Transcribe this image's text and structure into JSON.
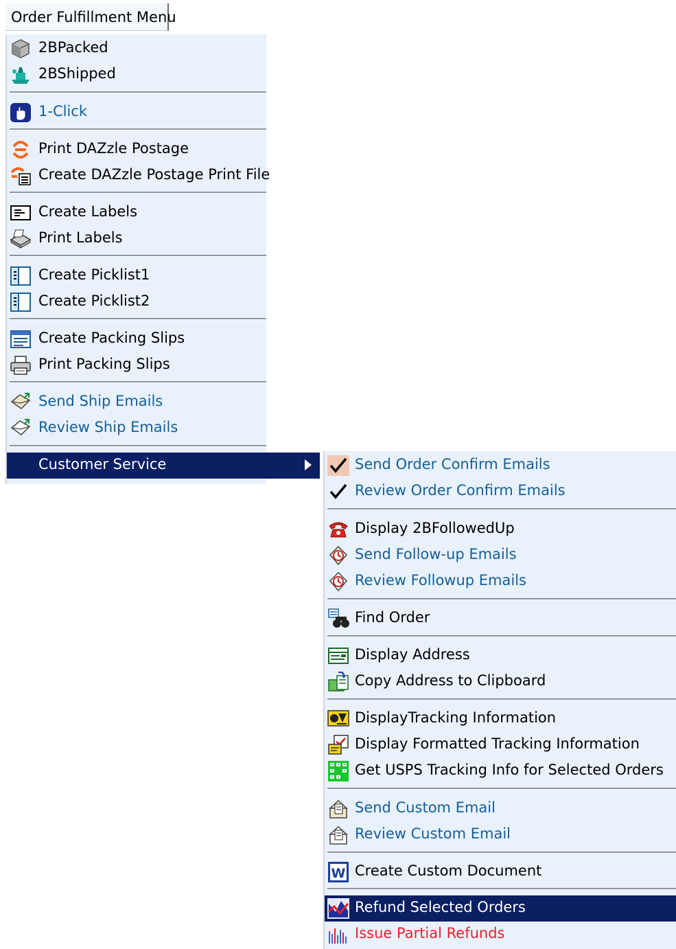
{
  "menubar": {
    "title": "Order Fulfillment Menu"
  },
  "main_menu": {
    "items": [
      {
        "label": "2BPacked",
        "icon": "box-icon"
      },
      {
        "label": "2BShipped",
        "icon": "ship-icon"
      },
      {
        "label": "1-Click",
        "icon": "hand-icon"
      },
      {
        "label": "Print DAZzle Postage",
        "icon": "dazzle-icon"
      },
      {
        "label": "Create DAZzle Postage Print File",
        "icon": "dazzle-file-icon"
      },
      {
        "label": "Create Labels",
        "icon": "label-icon"
      },
      {
        "label": "Print Labels",
        "icon": "printer-icon"
      },
      {
        "label": "Create Picklist1",
        "icon": "picklist-icon"
      },
      {
        "label": "Create Picklist2",
        "icon": "picklist-icon"
      },
      {
        "label": "Create Packing Slips",
        "icon": "packing-slip-icon"
      },
      {
        "label": "Print Packing Slips",
        "icon": "printer-icon"
      },
      {
        "label": "Send Ship Emails",
        "icon": "email-icon"
      },
      {
        "label": "Review Ship Emails",
        "icon": "email-icon"
      },
      {
        "label": "Customer Service",
        "icon": "submenu-arrow-icon"
      }
    ]
  },
  "sub_menu": {
    "items": [
      {
        "label": "Send Order Confirm Emails",
        "icon": "checkmark-icon"
      },
      {
        "label": "Review Order Confirm  Emails",
        "icon": "checkmark-icon"
      },
      {
        "label": "Display 2BFollowedUp",
        "icon": "telephone-icon"
      },
      {
        "label": "Send Follow-up Emails",
        "icon": "followup-icon"
      },
      {
        "label": "Review Followup Emails",
        "icon": "followup-icon"
      },
      {
        "label": "Find Order",
        "icon": "binoculars-icon"
      },
      {
        "label": "Display Address",
        "icon": "address-icon"
      },
      {
        "label": "Copy Address to Clipboard",
        "icon": "clipboard-icon"
      },
      {
        "label": "DisplayTracking Information",
        "icon": "tracking-icon"
      },
      {
        "label": "Display Formatted Tracking Information",
        "icon": "formatted-tracking-icon"
      },
      {
        "label": "Get USPS Tracking Info for Selected Orders",
        "icon": "usps-icon"
      },
      {
        "label": "Send Custom Email",
        "icon": "custom-email-icon"
      },
      {
        "label": "Review Custom Email",
        "icon": "custom-email-icon"
      },
      {
        "label": "Create Custom Document",
        "icon": "word-document-icon"
      },
      {
        "label": "Refund Selected Orders",
        "icon": "refund-icon"
      },
      {
        "label": "Issue Partial Refunds",
        "icon": "partial-refund-icon"
      }
    ]
  },
  "colors": {
    "menu_bg": "#e9f1fb",
    "highlight": "#0b1f63",
    "link_blue": "#14609a",
    "alert_red": "#e8202a"
  }
}
